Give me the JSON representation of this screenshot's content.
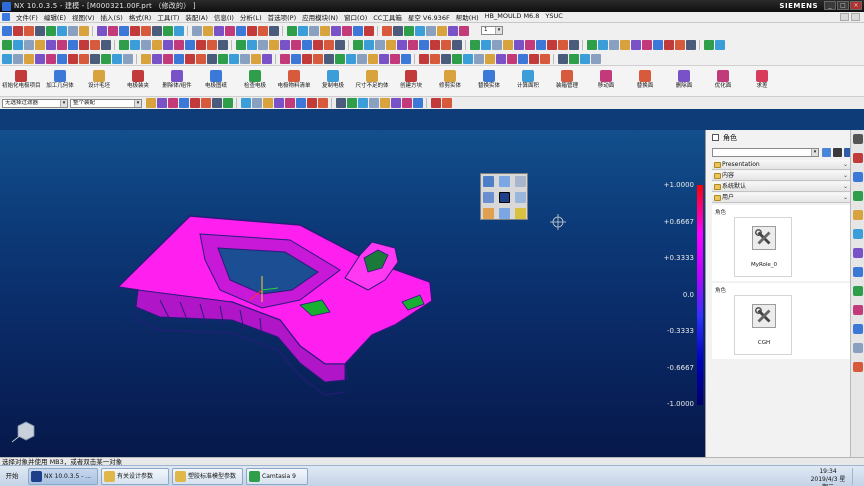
{
  "window": {
    "title": "NX 10.0.3.5 - 建模 - [M000321.00F.prt （修改的） ]",
    "brand": "SIEMENS"
  },
  "menu": [
    "文件(F)",
    "编辑(E)",
    "视图(V)",
    "插入(S)",
    "格式(R)",
    "工具(T)",
    "装配(A)",
    "信息(I)",
    "分析(L)",
    "首选项(P)",
    "应用模块(N)",
    "窗口(O)",
    "CC工具箱",
    "星空 V6.936F",
    "帮助(H)",
    "HB_MOULD M6.8",
    "YSUC"
  ],
  "toolbar": {
    "layer_combo": "1"
  },
  "ribbon": [
    {
      "icon": "mold-wizard-init-icon",
      "label": "初始化电极项目",
      "color": "#c23a3a"
    },
    {
      "icon": "machining-geometry-icon",
      "label": "加工几何体",
      "color": "#3c78d8"
    },
    {
      "icon": "design-blank-icon",
      "label": "设计毛坯",
      "color": "#d8a23c"
    },
    {
      "icon": "electrode-assembly-icon",
      "label": "电极装夹",
      "color": "#c23a3a"
    },
    {
      "icon": "delete-body-icon",
      "label": "删除体/组件",
      "color": "#7a52c7"
    },
    {
      "icon": "electrode-drawing-icon",
      "label": "电极图纸",
      "color": "#3c78d8"
    },
    {
      "icon": "check-electrode-icon",
      "label": "检查电极",
      "color": "#2e9e4a"
    },
    {
      "icon": "electrode-bom-icon",
      "label": "电极物料清单",
      "color": "#d85a3c"
    },
    {
      "icon": "copy-electrode-icon",
      "label": "复制电极",
      "color": "#3c9ed8"
    },
    {
      "icon": "dimension-blank-icon",
      "label": "尺寸不足的体",
      "color": "#d8a23c"
    },
    {
      "icon": "create-box-icon",
      "label": "创建方块",
      "color": "#c23a3a"
    },
    {
      "icon": "trim-solid-icon",
      "label": "修剪实体",
      "color": "#d8a23c"
    },
    {
      "icon": "replace-solid-icon",
      "label": "替换实体",
      "color": "#3c78d8"
    },
    {
      "icon": "calculate-area-icon",
      "label": "计算面积",
      "color": "#3c9ed8"
    },
    {
      "icon": "explorer-manager-icon",
      "label": "装箱管理",
      "color": "#d85a3c"
    },
    {
      "icon": "move-face-icon",
      "label": "移动面",
      "color": "#c23a7a"
    },
    {
      "icon": "replace-face-icon",
      "label": "替换面",
      "color": "#d85a3c"
    },
    {
      "icon": "delete-face-icon",
      "label": "删除面",
      "color": "#7a52c7"
    },
    {
      "icon": "optimize-face-icon",
      "label": "优化面",
      "color": "#c23a7a"
    },
    {
      "icon": "unsew-icon",
      "label": "求差",
      "color": "#d83c5a"
    }
  ],
  "filters": {
    "selection_filter": "无选择过滤器",
    "assembly_scope": "整个装配"
  },
  "legend": {
    "ticks": [
      "+1.0000",
      "+0.6667",
      "+0.3333",
      "0.0",
      "-0.3333",
      "-0.6667",
      "-1.0000"
    ]
  },
  "panel": {
    "title": "角色",
    "sections": [
      "Presentation",
      "内容",
      "系统默认",
      "用户"
    ],
    "groups": [
      {
        "label": "角色",
        "role": "MyRole_0"
      },
      {
        "label": "角色",
        "role": "CGH"
      }
    ]
  },
  "status": {
    "prompt": "选择对象并使用 MB3，或者双击某一对象"
  },
  "taskbar": {
    "start": "开始",
    "tasks": [
      {
        "label": "NX 10.0.3.5 - ...",
        "active": true
      },
      {
        "label": "有关设计参数",
        "active": false
      },
      {
        "label": "塑胶标准模型参数",
        "active": false
      },
      {
        "label": "Camtasia 9",
        "active": false
      }
    ],
    "time": "19:34",
    "date": "2019/4/3 星期三"
  },
  "colors": {
    "part_body": "#ff20f0",
    "part_edge": "#2a1b7a",
    "part_green": "#18b030",
    "viewport_top": "#124f8c",
    "viewport_bottom": "#06184a"
  }
}
